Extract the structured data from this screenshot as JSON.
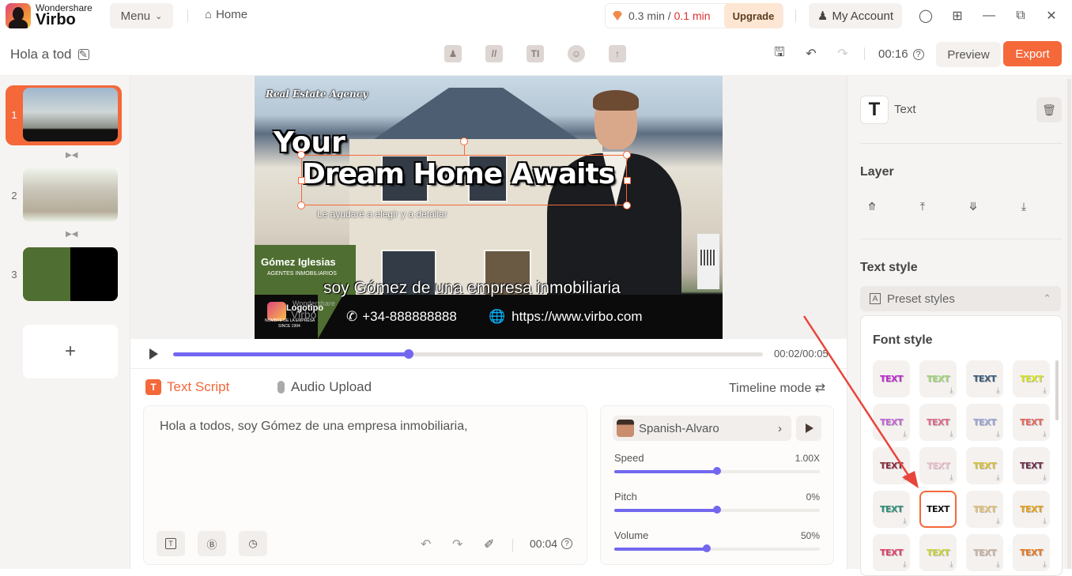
{
  "app": {
    "brand": "Wondershare",
    "name": "Virbo",
    "menu_label": "Menu",
    "home_label": "Home",
    "usage": {
      "used": "0.3 min",
      "separator": " / ",
      "remaining": "0.1 min"
    },
    "upgrade_label": "Upgrade",
    "account_label": "My Account"
  },
  "project": {
    "title": "Hola a tod",
    "duration": "00:16",
    "preview_label": "Preview",
    "export_label": "Export"
  },
  "toolbar_icons": [
    "avatar-icon",
    "background-icon",
    "text-icon",
    "sticker-icon",
    "upload-icon"
  ],
  "slides": [
    {
      "number": "1",
      "active": true
    },
    {
      "number": "2",
      "active": false
    },
    {
      "number": "3",
      "active": false
    }
  ],
  "add_slide_label": "+",
  "canvas": {
    "agency": "Real Estate Agency",
    "headline_line1": "Your",
    "headline_line2": "Dream Home Awaits",
    "subtitle": "Le ayudaré a elegir y a detallar",
    "company_name": "Gómez Iglesias",
    "company_sub": "AGENTES INMOBILIARIOS",
    "caption": "soy Gómez de una empresa inmobiliaria",
    "logo_text": "Logotipo",
    "watermark_brand": "Wondershare",
    "watermark_name": "Virbo",
    "company_line1": "NOMBRE DE LA EMPRESA",
    "company_line2": "SINCE 1994",
    "phone": "+34-888888888",
    "website": "https://www.virbo.com"
  },
  "playback": {
    "current": "00:02",
    "total": "00:05",
    "readout": "00:02/00:05",
    "progress_fraction": 0.4
  },
  "script": {
    "tab_text_script": "Text Script",
    "tab_audio_upload": "Audio Upload",
    "timeline_mode": "Timeline mode ⇄",
    "text": "Hola a todos, soy Gómez de una empresa inmobiliaria,",
    "duration": "00:04"
  },
  "voice": {
    "name": "Spanish-Alvaro",
    "params": [
      {
        "label": "Speed",
        "value": "1.00X",
        "fraction": 0.5
      },
      {
        "label": "Pitch",
        "value": "0%",
        "fraction": 0.5
      },
      {
        "label": "Volume",
        "value": "50%",
        "fraction": 0.45
      }
    ]
  },
  "right_panel": {
    "element_label": "Text",
    "layer_heading": "Layer",
    "text_style_heading": "Text style",
    "preset_styles_label": "Preset styles",
    "font_style_heading": "Font style",
    "font_styles": [
      {
        "label": "TEXT",
        "color": "#c026d3",
        "download": false,
        "selected": false
      },
      {
        "label": "TEXT",
        "color": "#a3d977",
        "download": true,
        "selected": false
      },
      {
        "label": "TEXT",
        "color": "#3a5a7a",
        "download": true,
        "selected": false
      },
      {
        "label": "TEXT",
        "color": "#d8e61e",
        "download": true,
        "selected": false
      },
      {
        "label": "TEXT",
        "color": "#c065d8",
        "download": true,
        "selected": false
      },
      {
        "label": "TEXT",
        "color": "#e06a8a",
        "download": true,
        "selected": false
      },
      {
        "label": "TEXT",
        "color": "#9aa6d8",
        "download": true,
        "selected": false
      },
      {
        "label": "TEXT",
        "color": "#e8645a",
        "download": true,
        "selected": false
      },
      {
        "label": "TEXT",
        "color": "#8a2b3a",
        "download": true,
        "selected": false
      },
      {
        "label": "TEXT",
        "color": "#f2c9d6",
        "download": true,
        "selected": false
      },
      {
        "label": "TEXT",
        "color": "#d9c23a",
        "download": true,
        "selected": false
      },
      {
        "label": "TEXT",
        "color": "#6a2d4a",
        "download": true,
        "selected": false
      },
      {
        "label": "TEXT",
        "color": "#2f8f7a",
        "download": true,
        "selected": false
      },
      {
        "label": "TEXT",
        "color": "#111111",
        "download": false,
        "selected": true
      },
      {
        "label": "TEXT",
        "color": "#e3c27a",
        "download": true,
        "selected": false
      },
      {
        "label": "TEXT",
        "color": "#e6a11a",
        "download": true,
        "selected": false
      },
      {
        "label": "TEXT",
        "color": "#e0406a",
        "download": true,
        "selected": false
      },
      {
        "label": "TEXT",
        "color": "#c9d83a",
        "download": true,
        "selected": false
      },
      {
        "label": "TEXT",
        "color": "#c9b7a8",
        "download": true,
        "selected": false
      },
      {
        "label": "TEXT",
        "color": "#e8761e",
        "download": true,
        "selected": false
      }
    ]
  },
  "colors": {
    "accent": "#f4683a",
    "slider": "#7367f0",
    "annotation_arrow": "#e8453c"
  }
}
